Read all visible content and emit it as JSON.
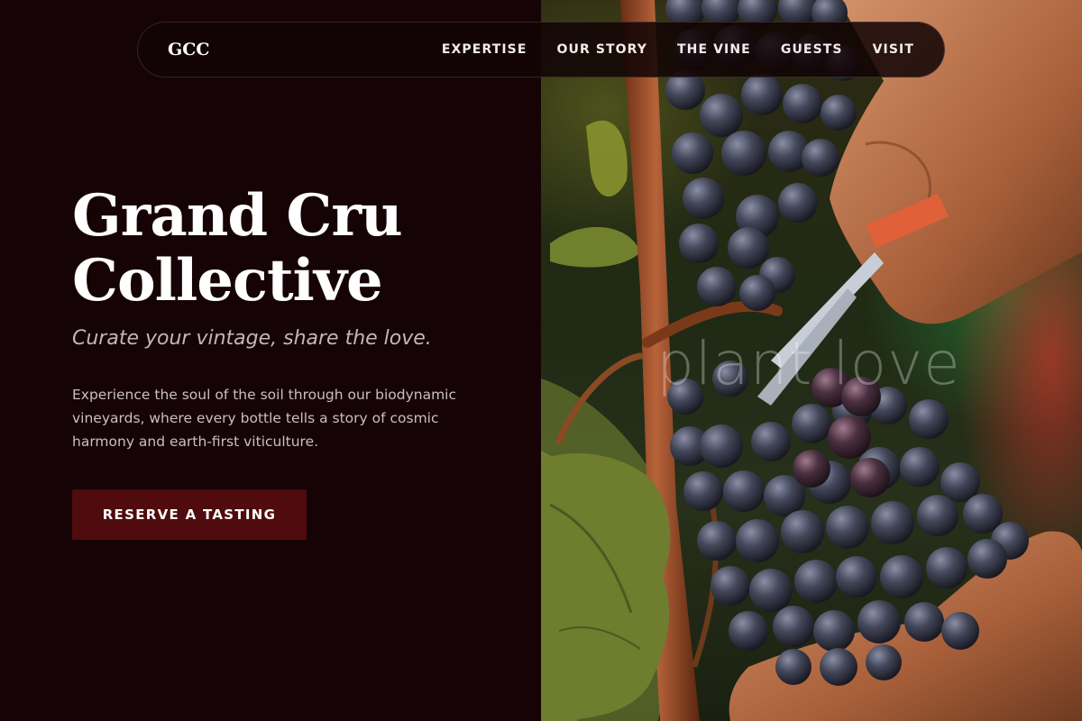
{
  "brand": {
    "logo": "GCC"
  },
  "nav": {
    "links": [
      {
        "label": "EXPERTISE"
      },
      {
        "label": "OUR STORY"
      },
      {
        "label": "THE VINE"
      },
      {
        "label": "GUESTS"
      },
      {
        "label": "VISIT"
      }
    ]
  },
  "hero": {
    "title_line1": "Grand Cru",
    "title_line2": "Collective",
    "tagline": "Curate your vintage, share the love.",
    "description": "Experience the soul of the soil through our biodynamic vineyards, where every bottle tells a story of cosmic harmony and earth-first viticulture.",
    "cta_label": "RESERVE A TASTING"
  },
  "image": {
    "alt": "Hands harvesting grapes with pruning shears",
    "watermark": "plant love"
  },
  "colors": {
    "background": "#160305",
    "cta_background": "#4f0b0d",
    "text_primary": "#ffffff",
    "text_muted": "#cdbfbf"
  }
}
